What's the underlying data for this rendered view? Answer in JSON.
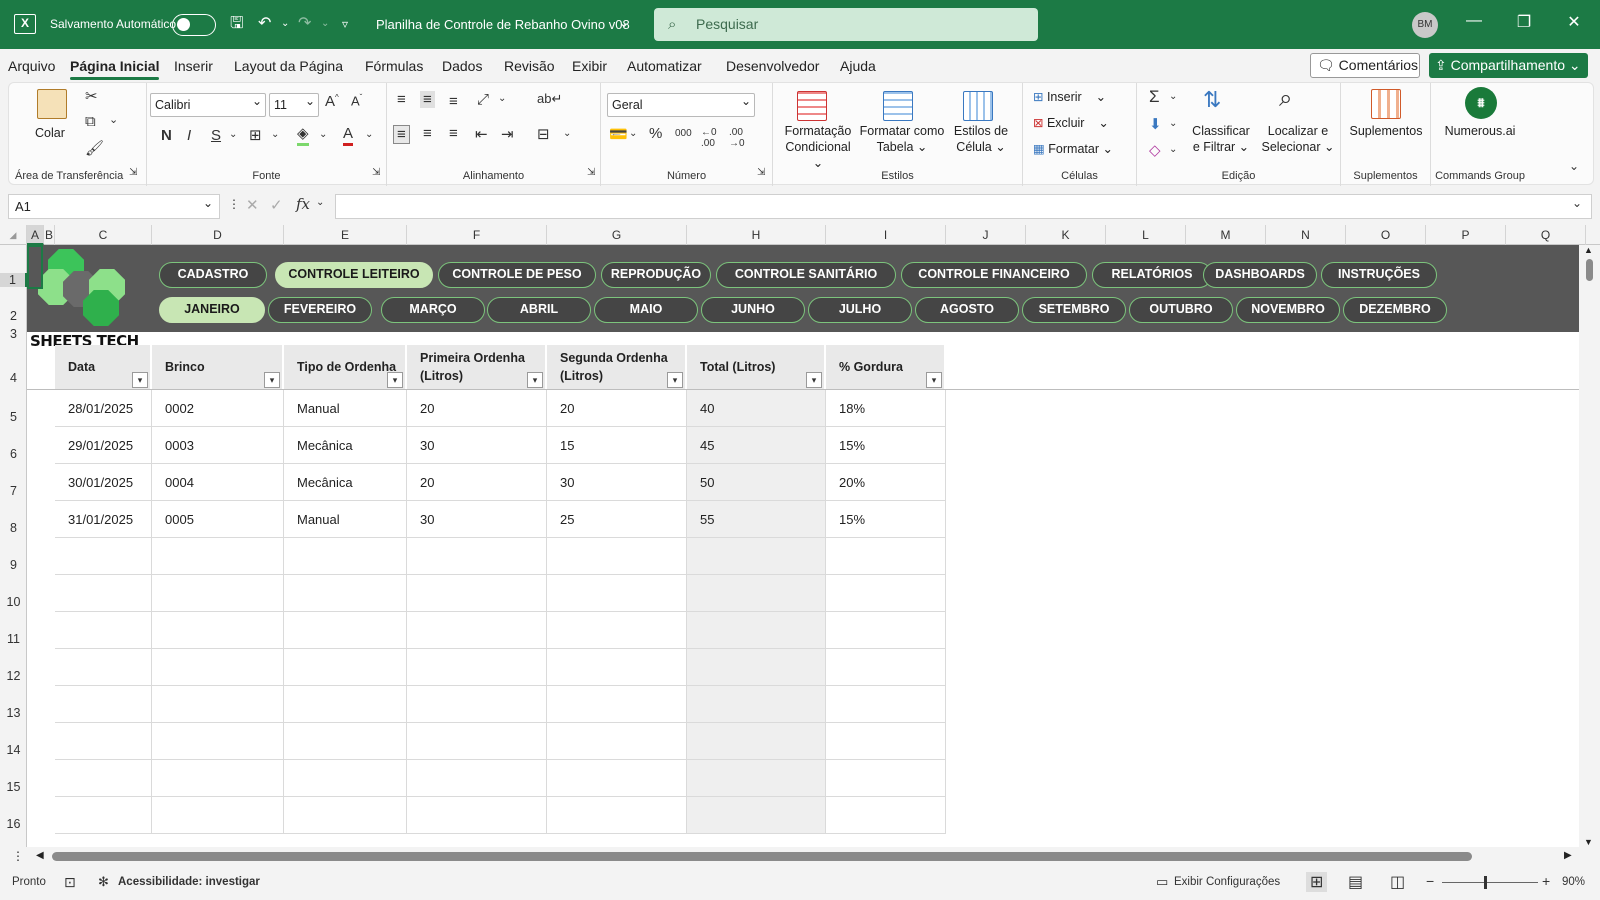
{
  "titlebar": {
    "app_icon": "excel-icon",
    "autosave_label": "Salvamento Automático",
    "file_name": "Planilha de Controle de Rebanho Ovino v08",
    "search_placeholder": "Pesquisar",
    "user_initials": "BM"
  },
  "menu": {
    "tabs": [
      "Arquivo",
      "Página Inicial",
      "Inserir",
      "Layout da Página",
      "Fórmulas",
      "Dados",
      "Revisão",
      "Exibir",
      "Automatizar",
      "Desenvolvedor",
      "Ajuda"
    ],
    "active_tab": "Página Inicial",
    "comments_label": "Comentários",
    "share_label": "Compartilhamento"
  },
  "ribbon": {
    "clipboard": {
      "paste_label": "Colar",
      "group_label": "Área de Transferência"
    },
    "font": {
      "family": "Calibri",
      "size": "11",
      "bold": "N",
      "italic": "I",
      "underline": "S",
      "group_label": "Fonte"
    },
    "alignment": {
      "group_label": "Alinhamento"
    },
    "number": {
      "format": "Geral",
      "group_label": "Número"
    },
    "styles": {
      "conditional_l1": "Formatação",
      "conditional_l2": "Condicional",
      "table_l1": "Formatar como",
      "table_l2": "Tabela",
      "cell_l1": "Estilos de",
      "cell_l2": "Célula",
      "group_label": "Estilos"
    },
    "cells": {
      "insert": "Inserir",
      "delete": "Excluir",
      "format": "Formatar",
      "group_label": "Células"
    },
    "editing": {
      "sort_l1": "Classificar",
      "sort_l2": "e Filtrar",
      "find_l1": "Localizar e",
      "find_l2": "Selecionar",
      "group_label": "Edição"
    },
    "addins": {
      "label": "Suplementos",
      "group_label": "Suplementos"
    },
    "commands": {
      "label": "Numerous.ai",
      "group_label": "Commands Group"
    }
  },
  "formula_bar": {
    "name_box": "A1",
    "fx": "fx",
    "formula": ""
  },
  "sheet": {
    "columns": [
      "A",
      "B",
      "C",
      "D",
      "E",
      "F",
      "G",
      "H",
      "I",
      "J",
      "K",
      "L",
      "M",
      "N",
      "O",
      "P",
      "Q"
    ],
    "rows": [
      "1",
      "2",
      "3",
      "4",
      "5",
      "6",
      "7",
      "8",
      "9",
      "10",
      "11",
      "12",
      "13",
      "14",
      "15",
      "16"
    ],
    "brand": "SHEETS TECH",
    "nav_main": [
      "CADASTRO",
      "CONTROLE LEITEIRO",
      "CONTROLE DE PESO",
      "REPRODUÇÃO",
      "CONTROLE SANITÁRIO",
      "CONTROLE FINANCEIRO",
      "RELATÓRIOS",
      "DASHBOARDS",
      "INSTRUÇÕES"
    ],
    "nav_main_selected": "CONTROLE LEITEIRO",
    "nav_months": [
      "JANEIRO",
      "FEVEREIRO",
      "MARÇO",
      "ABRIL",
      "MAIO",
      "JUNHO",
      "JULHO",
      "AGOSTO",
      "SETEMBRO",
      "OUTUBRO",
      "NOVEMBRO",
      "DEZEMBRO"
    ],
    "nav_month_selected": "JANEIRO",
    "table": {
      "headers": [
        {
          "l1": "Data",
          "l2": ""
        },
        {
          "l1": "Brinco",
          "l2": ""
        },
        {
          "l1": "Tipo de Ordenha",
          "l2": ""
        },
        {
          "l1": "Primeira Ordenha",
          "l2": "(Litros)"
        },
        {
          "l1": "Segunda Ordenha",
          "l2": "(Litros)"
        },
        {
          "l1": "Total (Litros)",
          "l2": ""
        },
        {
          "l1": "% Gordura",
          "l2": ""
        }
      ],
      "rows": [
        [
          "28/01/2025",
          "0002",
          "Manual",
          "20",
          "20",
          "40",
          "18%"
        ],
        [
          "29/01/2025",
          "0003",
          "Mecânica",
          "30",
          "15",
          "45",
          "15%"
        ],
        [
          "30/01/2025",
          "0004",
          "Mecânica",
          "20",
          "30",
          "50",
          "20%"
        ],
        [
          "31/01/2025",
          "0005",
          "Manual",
          "30",
          "25",
          "55",
          "15%"
        ]
      ]
    }
  },
  "status": {
    "ready": "Pronto",
    "accessibility": "Acessibilidade: investigar",
    "display_settings": "Exibir Configurações",
    "zoom": "90%"
  },
  "colors": {
    "accent": "#1c7a45",
    "band": "#575757",
    "pill_border": "#7cc47c",
    "pill_selected": "#c8e6b4"
  }
}
